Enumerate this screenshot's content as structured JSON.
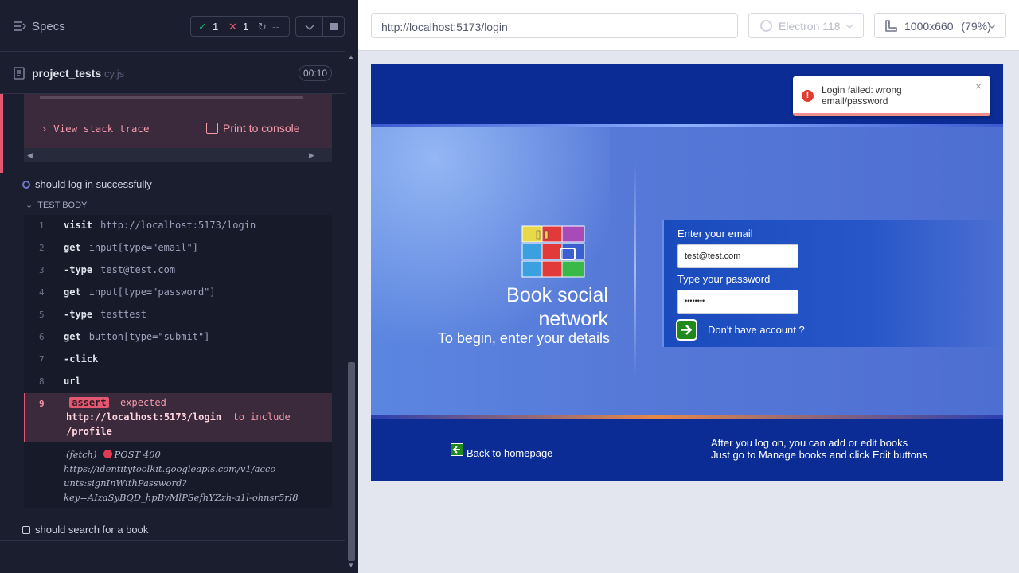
{
  "reporter": {
    "specs_label": "Specs",
    "stats": {
      "passed": "1",
      "failed": "1",
      "pending": "--"
    },
    "file": {
      "name": "project_tests",
      "ext": "cy.js",
      "duration": "00:10"
    },
    "error": {
      "stack_trace": "View stack trace",
      "print_console": "Print to console"
    },
    "tests": [
      {
        "title": "should log in successfully"
      },
      {
        "title": "should search for a book"
      }
    ],
    "test_body_label": "TEST BODY",
    "commands": [
      {
        "num": "1",
        "name": "visit",
        "msg": "http://localhost:5173/login"
      },
      {
        "num": "2",
        "name": "get",
        "msg": "input[type=\"email\"]"
      },
      {
        "num": "3",
        "name": "-type",
        "msg": "test@test.com"
      },
      {
        "num": "4",
        "name": "get",
        "msg": "input[type=\"password\"]"
      },
      {
        "num": "5",
        "name": "-type",
        "msg": "testtest"
      },
      {
        "num": "6",
        "name": "get",
        "msg": "button[type=\"submit\"]"
      },
      {
        "num": "7",
        "name": "-click",
        "msg": ""
      },
      {
        "num": "8",
        "name": "url",
        "msg": ""
      }
    ],
    "assert": {
      "num": "9",
      "prefix": "-",
      "badge": "assert",
      "word_expected": "expected",
      "value": "http://localhost:5173/login",
      "word_include": "to include",
      "target": "/profile"
    },
    "fetch": {
      "label": "(fetch)",
      "status": "POST 400",
      "url_line1": "https://identitytoolkit.googleapis.com/v1/acco",
      "url_line2": "unts:signInWithPassword?",
      "url_line3": "key=AIzaSyBQD_hpBvMlPSefhYZzh-a1l-ohnsr5rI8"
    }
  },
  "browser": {
    "url": "http://localhost:5173/login",
    "browser_name": "Electron 118",
    "viewport": "1000x660",
    "zoom": "(79%)"
  },
  "app": {
    "title_line1": "Book social",
    "title_line2": "network",
    "subtitle": "To begin, enter your details",
    "email_label": "Enter your email",
    "email_value": "test@test.com",
    "password_label": "Type your password",
    "password_value": "••••••••",
    "signup_link": "Don't have account ?",
    "back_home": "Back to homepage",
    "footer_line1": "After you log on, you can add or edit books",
    "footer_line2": "Just go to Manage books and click Edit buttons",
    "toast_message": "Login failed: wrong email/password",
    "toast_close": "×"
  },
  "colors": {
    "fail": "#e45770",
    "pass": "#1fa971",
    "app_blue": "#0a2c94"
  }
}
